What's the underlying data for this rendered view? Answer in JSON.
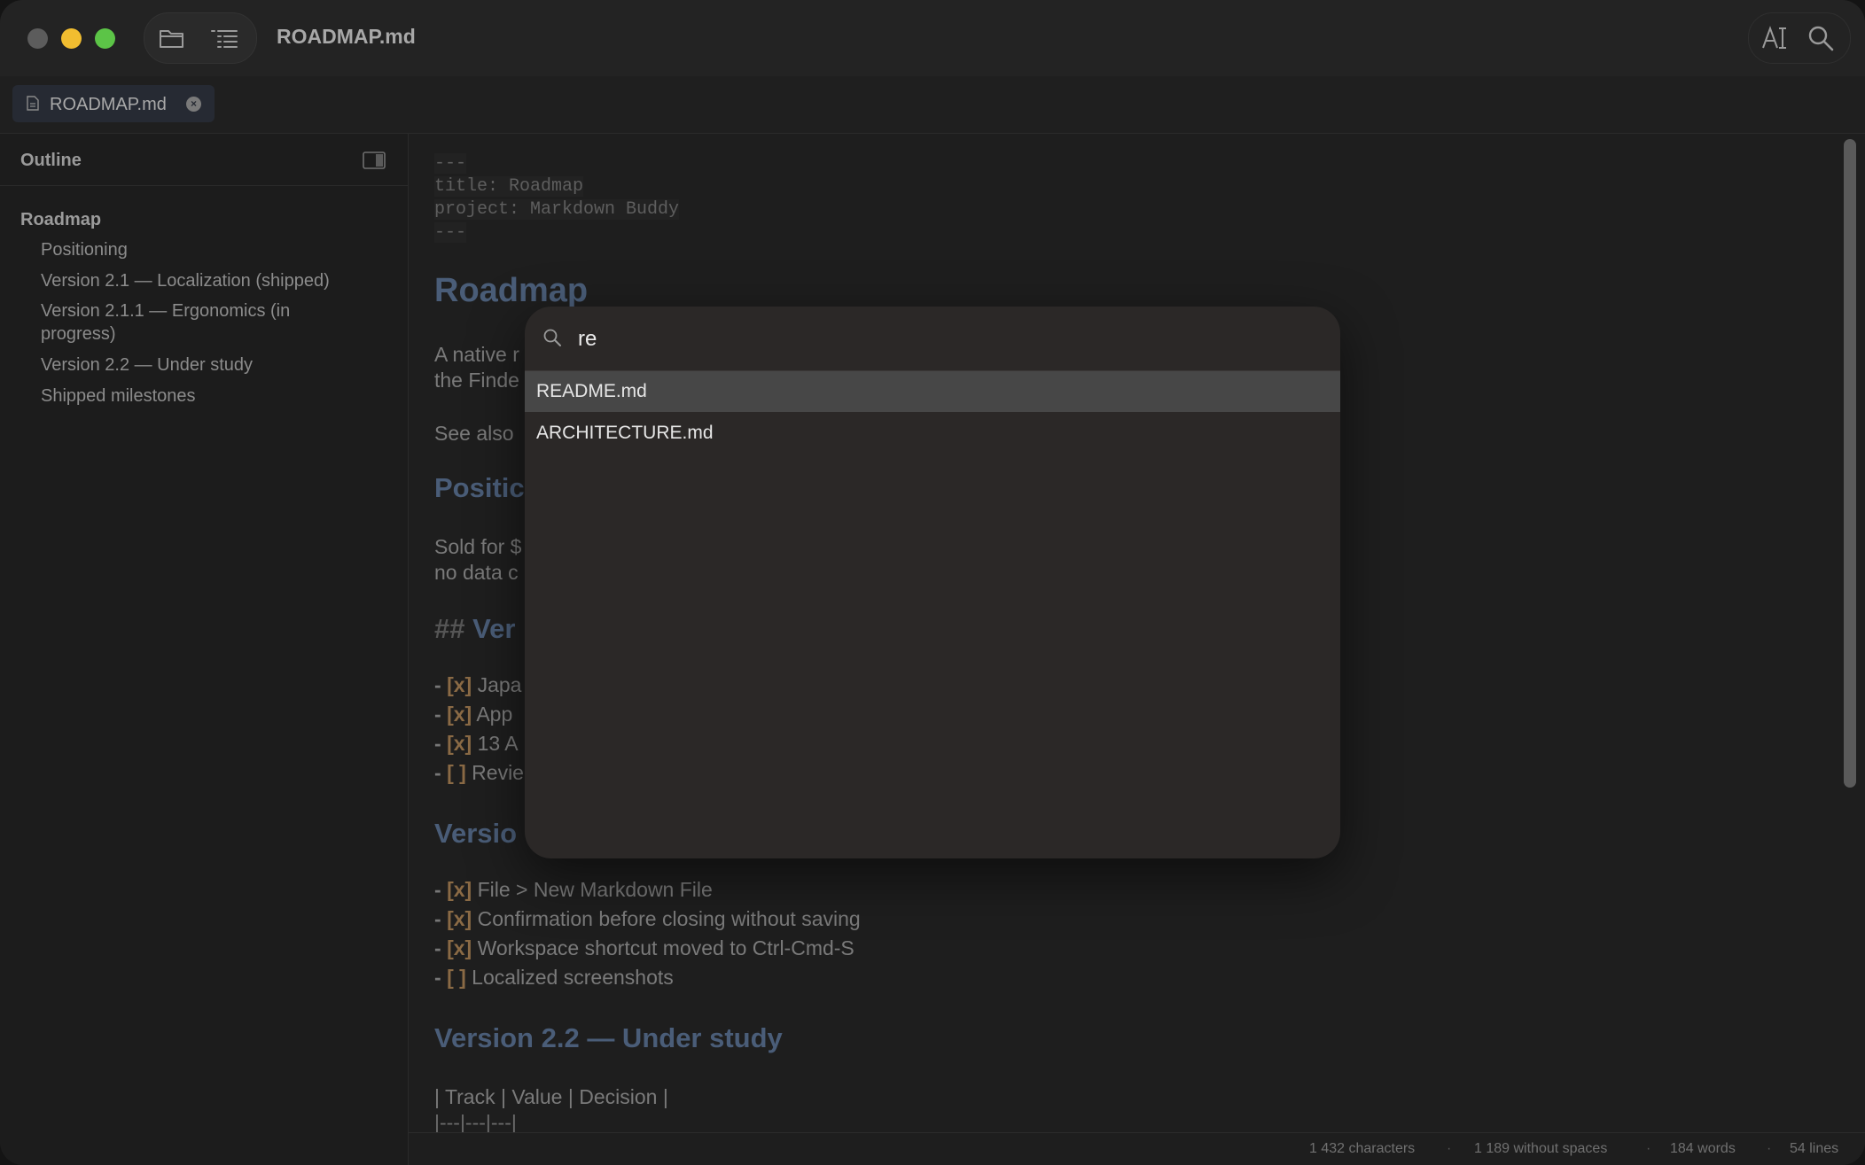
{
  "window": {
    "title": "ROADMAP.md"
  },
  "tabs": [
    {
      "label": "ROADMAP.md",
      "active": true
    }
  ],
  "sidebar": {
    "title": "Outline",
    "items": [
      {
        "label": "Roadmap"
      },
      {
        "label": "Positioning"
      },
      {
        "label": "Version 2.1 — Localization (shipped)"
      },
      {
        "label": "Version 2.1.1 — Ergonomics (in progress)"
      },
      {
        "label": "Version 2.2 — Under study"
      },
      {
        "label": "Shipped milestones"
      }
    ]
  },
  "editor": {
    "frontmatter": [
      "---",
      "title: Roadmap",
      "project: Markdown Buddy",
      "---"
    ],
    "h1": "Roadmap",
    "para1_line1": "A native r",
    "para1_line2": "the Finde",
    "see_also": "See also",
    "h2_positioning": "Positic",
    "para2_line1": "Sold for $",
    "para2_line2": "no data c",
    "h2_version_hash": "##",
    "h2_version_partial": "Ver",
    "tasks_a": [
      {
        "dash": "-",
        "box": "[x]",
        "text": "Japa"
      },
      {
        "dash": "-",
        "box": "[x]",
        "text": "App"
      },
      {
        "dash": "-",
        "box": "[x]",
        "text": "13 A"
      },
      {
        "dash": "-",
        "box": "[ ]",
        "text": "Revie"
      }
    ],
    "h2_version_b": "Versio",
    "tasks_b": [
      {
        "dash": "-",
        "box": "[x]",
        "text": "File > New Markdown File"
      },
      {
        "dash": "-",
        "box": "[x]",
        "text": "Confirmation before closing without saving"
      },
      {
        "dash": "-",
        "box": "[x]",
        "text": "Workspace shortcut moved to Ctrl-Cmd-S"
      },
      {
        "dash": "-",
        "box": "[ ]",
        "text": "Localized screenshots"
      }
    ],
    "h2_under_study": "Version 2.2 — Under study",
    "table_header": "| Track | Value | Decision |",
    "table_sep": "|---|---|---|"
  },
  "statusbar": {
    "characters": "1 432 characters",
    "without_spaces": "1 189 without spaces",
    "words": "184 words",
    "lines": "54 lines",
    "separator": "·"
  },
  "quick_open": {
    "query": "re",
    "results": [
      {
        "label": "README.md",
        "selected": true
      },
      {
        "label": "ARCHITECTURE.md",
        "selected": false
      }
    ]
  },
  "colors": {
    "accent_heading": "#4a5d78",
    "checkbox": "#8a6a45",
    "traffic_close": "#5c5c5c",
    "traffic_min": "#f1bd30",
    "traffic_max": "#5cc447"
  }
}
